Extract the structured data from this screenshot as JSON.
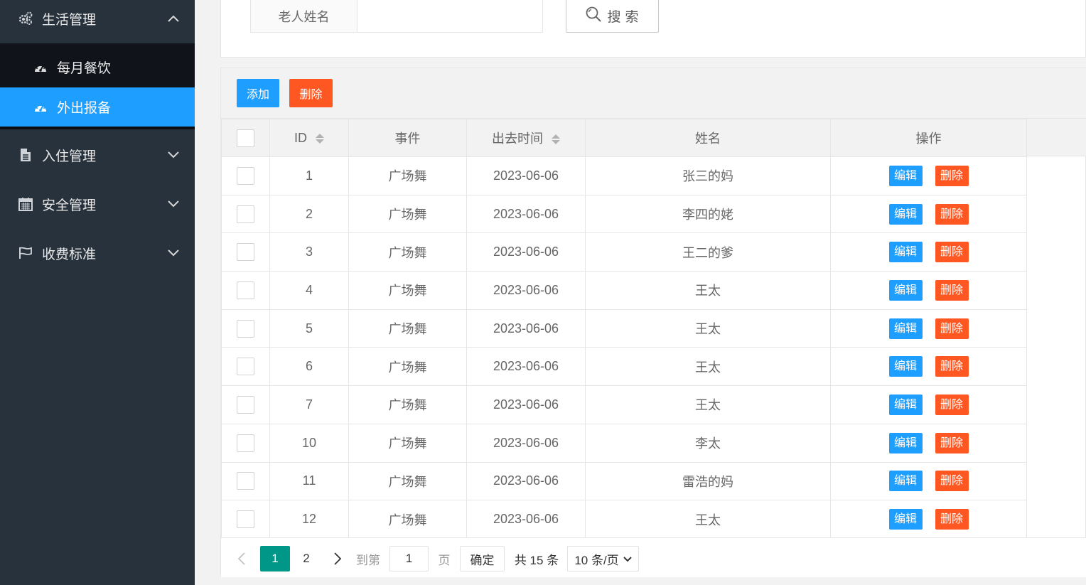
{
  "sidebar": {
    "groups": [
      {
        "label": "生活管理",
        "icon": "gears-icon",
        "expanded": true
      },
      {
        "label": "入住管理",
        "icon": "file-icon",
        "expanded": false
      },
      {
        "label": "安全管理",
        "icon": "calendar-icon",
        "expanded": false
      },
      {
        "label": "收费标准",
        "icon": "flag-icon",
        "expanded": false
      }
    ],
    "sub_items": [
      {
        "label": "每月餐饮",
        "icon": "dashboard-icon",
        "active": false
      },
      {
        "label": "外出报备",
        "icon": "dashboard-icon",
        "active": true
      }
    ]
  },
  "search": {
    "label": "老人姓名",
    "value": "",
    "placeholder": "",
    "button_label": "搜 索"
  },
  "toolbar": {
    "add_label": "添加",
    "delete_label": "删除"
  },
  "table": {
    "headers": {
      "id": "ID",
      "event": "事件",
      "time": "出去时间",
      "name": "姓名",
      "ops": "操作"
    },
    "rows": [
      {
        "id": "1",
        "event": "广场舞",
        "time": "2023-06-06",
        "name": "张三的妈"
      },
      {
        "id": "2",
        "event": "广场舞",
        "time": "2023-06-06",
        "name": "李四的姥"
      },
      {
        "id": "3",
        "event": "广场舞",
        "time": "2023-06-06",
        "name": "王二的爹"
      },
      {
        "id": "4",
        "event": "广场舞",
        "time": "2023-06-06",
        "name": "王太"
      },
      {
        "id": "5",
        "event": "广场舞",
        "time": "2023-06-06",
        "name": "王太"
      },
      {
        "id": "6",
        "event": "广场舞",
        "time": "2023-06-06",
        "name": "王太"
      },
      {
        "id": "7",
        "event": "广场舞",
        "time": "2023-06-06",
        "name": "王太"
      },
      {
        "id": "10",
        "event": "广场舞",
        "time": "2023-06-06",
        "name": "李太"
      },
      {
        "id": "11",
        "event": "广场舞",
        "time": "2023-06-06",
        "name": "雷浩的妈"
      },
      {
        "id": "12",
        "event": "广场舞",
        "time": "2023-06-06",
        "name": "王太"
      }
    ],
    "edit_label": "编辑",
    "delete_label": "删除"
  },
  "pagination": {
    "prev": "‹",
    "pages": [
      "1",
      "2"
    ],
    "current": "1",
    "next": "›",
    "goto_label": "到第",
    "goto_value": "1",
    "page_unit": "页",
    "confirm_label": "确定",
    "total_text": "共 15 条",
    "page_size": "10 条/页"
  },
  "colors": {
    "sidebar_bg": "#28323d",
    "submenu_bg": "#10141a",
    "active_blue": "#1e9fff",
    "danger_orange": "#ff5722",
    "pager_teal": "#009688"
  }
}
